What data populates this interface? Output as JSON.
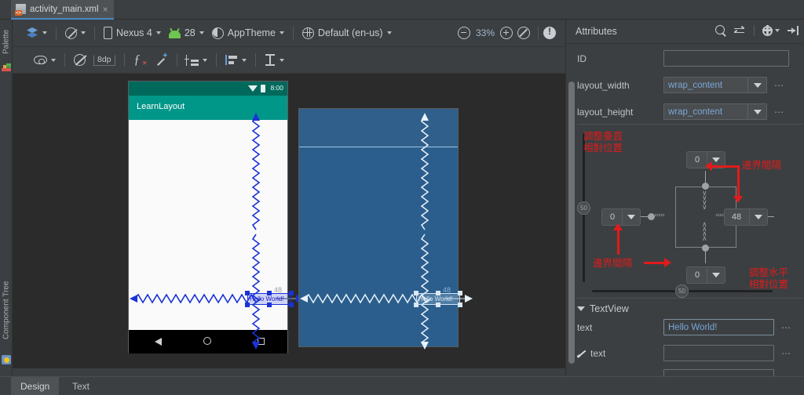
{
  "window": {
    "tab": {
      "filename": "activity_main.xml",
      "close": "×",
      "icon": "xml-file-icon"
    }
  },
  "left_rail": {
    "palette_label": "Palette",
    "component_tree_label": "Component Tree"
  },
  "toolbar": {
    "design_mode": {
      "label": "",
      "icon": "layers-icon"
    },
    "orientation": {
      "label": "",
      "icon": "orientation-icon"
    },
    "device": {
      "label": "Nexus 4",
      "icon": "phone-icon"
    },
    "api_level": {
      "label": "28",
      "icon": "android-icon"
    },
    "theme": {
      "label": "AppTheme",
      "icon": "theme-icon"
    },
    "locale": {
      "label": "Default (en-us)",
      "icon": "globe-icon"
    },
    "zoom_out": "zoom-out-icon",
    "zoom_level": "33%",
    "zoom_in": "zoom-in-icon",
    "zoom_fit": "zoom-fit-icon",
    "warnings": "warning-icon"
  },
  "toolbar2": {
    "view_options": "eye-icon",
    "autoconnect": "magnet-off-icon",
    "default_margin": "8dp",
    "clear_constraints": "clear-constraints-icon",
    "infer_constraints": "infer-constraints-icon",
    "pack": "pack-icon",
    "align": "align-icon",
    "guidelines": "guidelines-icon"
  },
  "canvas": {
    "device_preview": {
      "status_bar": {
        "time": "8:00",
        "wifi": "wifi-icon",
        "battery": "battery-icon"
      },
      "app_bar_title": "LearnLayout",
      "text_widget": "Hello World!",
      "margin_right_label": "48",
      "nav_bar": {
        "back": "back-icon",
        "home": "home-icon",
        "recents": "recents-icon"
      }
    },
    "blueprint_preview": {
      "text_widget": "Hello World!",
      "margin_right_label": "48"
    }
  },
  "attributes": {
    "title": "Attributes",
    "tools": {
      "search": "search-icon",
      "sort": "swap-icon",
      "settings": "gear-icon",
      "collapse": "collapse-panel-icon"
    },
    "rows": [
      {
        "label": "ID",
        "value": "",
        "type": "input"
      },
      {
        "label": "layout_width",
        "value": "wrap_content",
        "type": "combo"
      },
      {
        "label": "layout_height",
        "value": "wrap_content",
        "type": "combo"
      }
    ],
    "dots": "⋯"
  },
  "constraint_widget": {
    "top_margin": "0",
    "left_margin": "0",
    "right_margin": "48",
    "bottom_margin": "0",
    "vertical_bias": "50",
    "horizontal_bias": "50"
  },
  "annotations": [
    {
      "id": "vertical-bias-note",
      "text_line1": "調整垂直",
      "text_line2": "相對位置"
    },
    {
      "id": "right-margin-note",
      "text_line1": "邊界間隔"
    },
    {
      "id": "left-margin-note",
      "text_line1": "邊界間隔"
    },
    {
      "id": "horizontal-bias-note",
      "text_line1": "調整水平",
      "text_line2": "相對位置"
    }
  ],
  "textview_section": {
    "header": "TextView",
    "rows": [
      {
        "label": "text",
        "value": "Hello World!",
        "icon": ""
      },
      {
        "label": "text",
        "value": "",
        "icon": "brush-icon"
      },
      {
        "label": "",
        "value": "",
        "icon": ""
      }
    ]
  },
  "bottom_tabs": [
    {
      "label": "Design",
      "active": true
    },
    {
      "label": "Text",
      "active": false
    }
  ],
  "colors": {
    "accent_tab": "#4a88c7",
    "app_bar": "#009688",
    "status_bar": "#00695c",
    "blueprint": "#2b5e8c",
    "constraint_blue": "#1a32d8",
    "annotation_red": "#e01b1b",
    "value_text": "#7aa6d8"
  }
}
